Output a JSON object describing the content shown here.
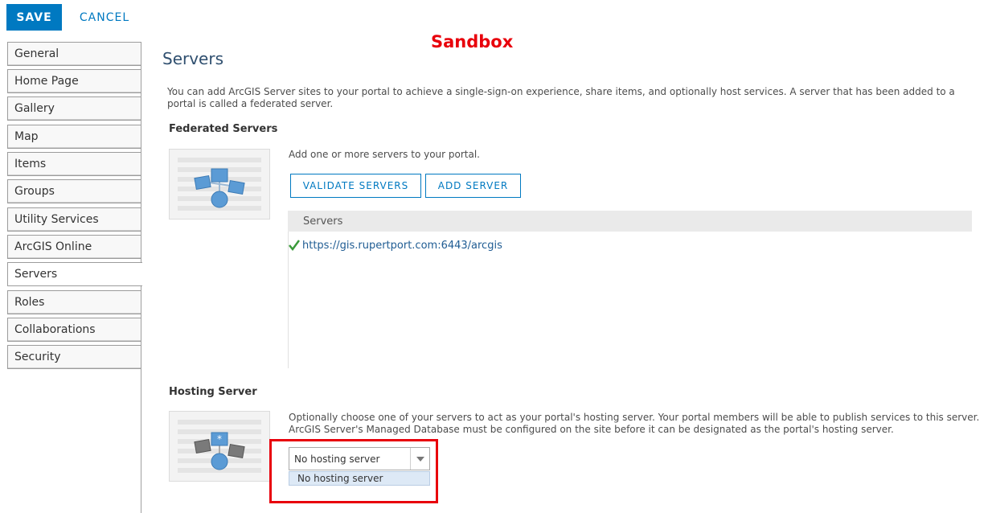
{
  "toolbar": {
    "save_label": "SAVE",
    "cancel_label": "CANCEL"
  },
  "annotation": {
    "sandbox_label": "Sandbox",
    "highlight_color": "#e8000b"
  },
  "sidebar": {
    "items": [
      {
        "label": "General",
        "active": false
      },
      {
        "label": "Home Page",
        "active": false
      },
      {
        "label": "Gallery",
        "active": false
      },
      {
        "label": "Map",
        "active": false
      },
      {
        "label": "Items",
        "active": false
      },
      {
        "label": "Groups",
        "active": false
      },
      {
        "label": "Utility Services",
        "active": false
      },
      {
        "label": "ArcGIS Online",
        "active": false
      },
      {
        "label": "Servers",
        "active": true
      },
      {
        "label": "Roles",
        "active": false
      },
      {
        "label": "Collaborations",
        "active": false
      },
      {
        "label": "Security",
        "active": false
      }
    ]
  },
  "main": {
    "title": "Servers",
    "intro": "You can add ArcGIS Server sites to your portal to achieve a single-sign-on experience, share items, and optionally host services. A server that has been added to a portal is called a federated server.",
    "federated": {
      "title": "Federated Servers",
      "add_text": "Add one or more servers to your portal.",
      "validate_label": "VALIDATE SERVERS",
      "add_label": "ADD SERVER",
      "list_header": "Servers",
      "servers": [
        {
          "url": "https://gis.rupertport.com:6443/arcgis",
          "status_icon": "check-icon"
        }
      ]
    },
    "hosting": {
      "title": "Hosting Server",
      "description": "Optionally choose one of your servers to act as your portal's hosting server. Your portal members will be able to publish services to this server. ArcGIS Server's Managed Database must be configured on the site before it can be designated as the portal's hosting server.",
      "selected": "No hosting server",
      "options": [
        "No hosting server"
      ]
    }
  },
  "colors": {
    "accent": "#0079c1",
    "link": "#1f5c93",
    "check": "#3a9a3a"
  }
}
